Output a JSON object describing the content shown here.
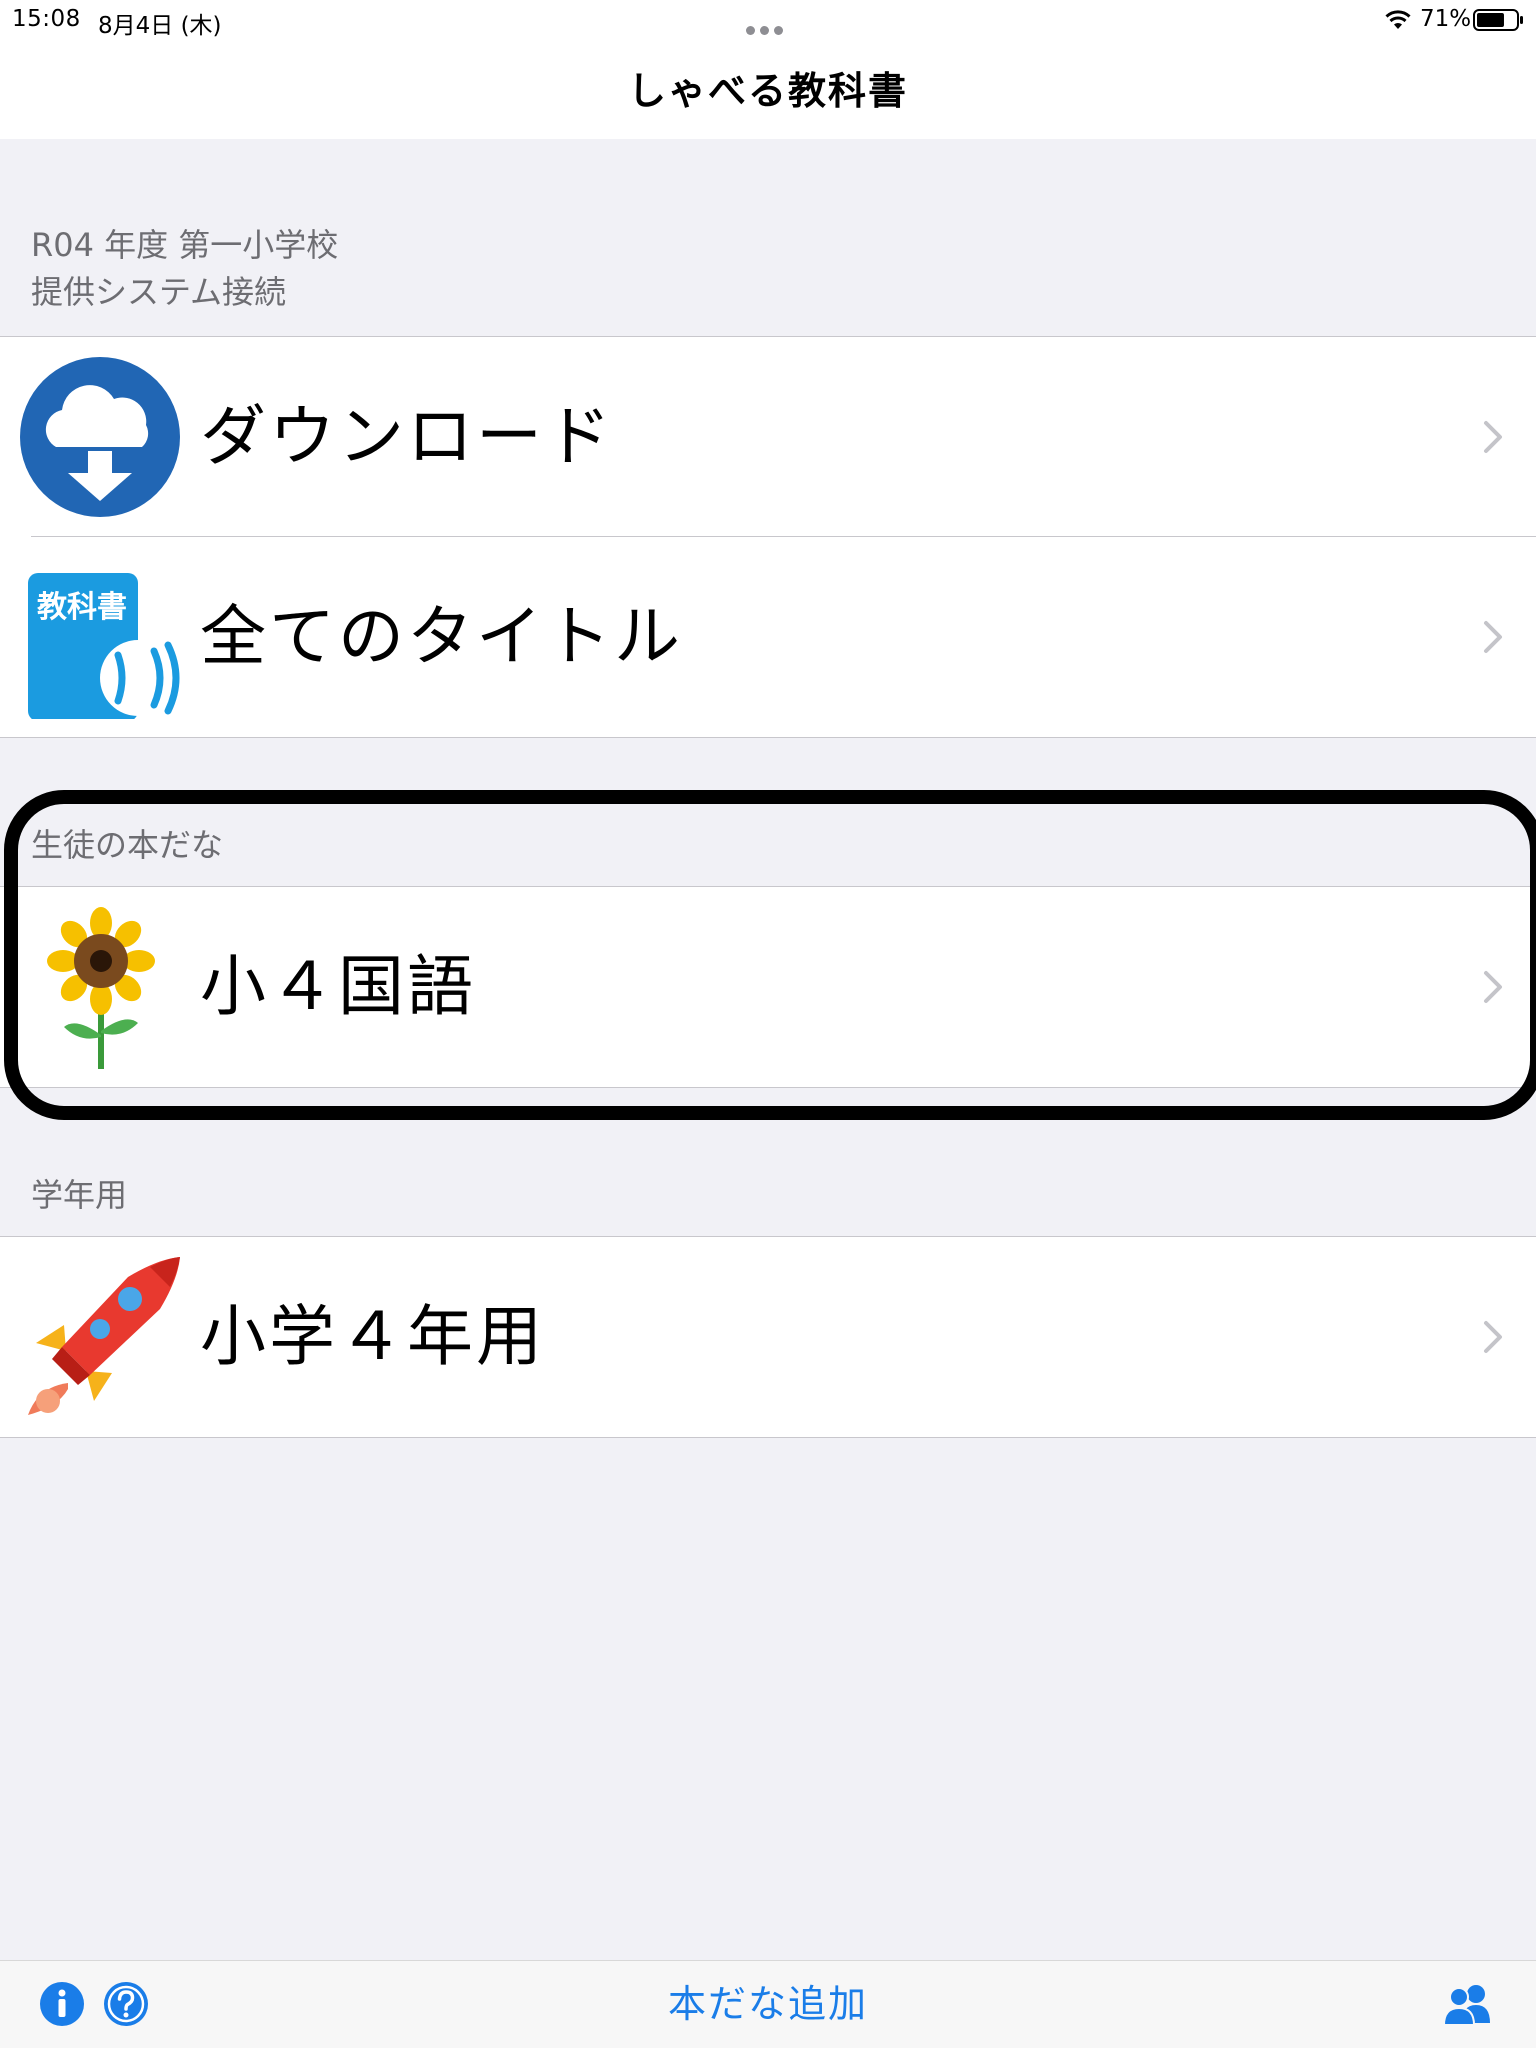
{
  "status_bar": {
    "time": "15:08",
    "date": "8月4日 (木)",
    "battery_percent": "71%",
    "battery_level": 0.71
  },
  "nav": {
    "title": "しゃべる教科書"
  },
  "sections": {
    "system": {
      "header_line1": "R04 年度 第一小学校",
      "header_line2": "提供システム接続",
      "rows": [
        {
          "label": "ダウンロード",
          "icon": "cloud-download-icon"
        },
        {
          "label": "全てのタイトル",
          "icon": "textbook-speaker-icon",
          "icon_text": "教科書"
        }
      ]
    },
    "student_shelf": {
      "header": "生徒の本だな",
      "rows": [
        {
          "label": "小４国語",
          "icon": "sunflower-icon"
        }
      ]
    },
    "grade": {
      "header": "学年用",
      "rows": [
        {
          "label": "小学４年用",
          "icon": "rocket-icon"
        }
      ]
    }
  },
  "toolbar": {
    "add_shelf_label": "本だな追加",
    "left_icons": [
      "info-icon",
      "help-icon"
    ],
    "right_icon": "users-icon"
  },
  "colors": {
    "accent": "#1a7de8",
    "background": "#f1f1f6",
    "download_icon_blue": "#2166b4",
    "textbook_icon_blue": "#1b9be0"
  }
}
